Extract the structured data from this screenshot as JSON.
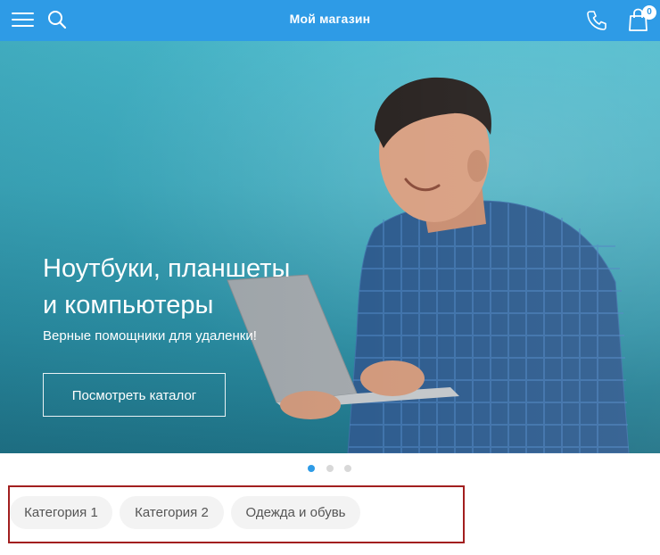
{
  "header": {
    "title": "Мой магазин",
    "cart_count": "0"
  },
  "hero": {
    "title_line1": "Ноутбуки, планшеты",
    "title_line2": "и компьютеры",
    "subtitle": "Верные помощники для удаленки!",
    "button_label": "Посмотреть каталог"
  },
  "carousel": {
    "slides": 3,
    "active": 1
  },
  "categories": [
    {
      "label": "Категория 1"
    },
    {
      "label": "Категория 2"
    },
    {
      "label": "Одежда и обувь"
    }
  ],
  "colors": {
    "accent": "#2e9be6",
    "highlight_border": "#a21f1f"
  }
}
